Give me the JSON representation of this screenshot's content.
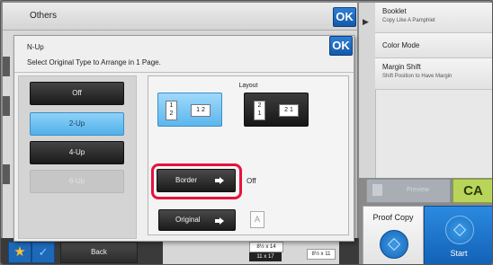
{
  "others_window": {
    "title": "Others",
    "ok_label": "OK"
  },
  "sidebar": {
    "items": [
      {
        "title": "Booklet",
        "subtitle": "Copy Like A Pamphlet"
      },
      {
        "title": "Color Mode",
        "subtitle": ""
      },
      {
        "title": "Margin Shift",
        "subtitle": "Shift Position to Have Margin"
      }
    ]
  },
  "actions": {
    "preview_label": "Preview",
    "ca_label": "CA",
    "proof_copy_label": "Proof Copy",
    "start_label": "Start",
    "back_label": "Back"
  },
  "trays": {
    "paper_1": "8½ x 14",
    "paper_2": "11 x 17",
    "paper_3": "8½ x 11"
  },
  "nup_dialog": {
    "title": "N-Up",
    "ok_label": "OK",
    "instruction": "Select Original Type to Arrange in 1 Page.",
    "options": [
      {
        "label": "Off",
        "state": "normal"
      },
      {
        "label": "2-Up",
        "state": "selected"
      },
      {
        "label": "4-Up",
        "state": "normal"
      },
      {
        "label": "6-Up",
        "state": "disabled"
      }
    ],
    "layout_label": "Layout",
    "layout_a": {
      "p1": "1",
      "p2": "2",
      "p3": "1",
      "p4": "2"
    },
    "layout_b": {
      "p1": "2",
      "p2": "1",
      "p3": "2",
      "p4": "1"
    },
    "border_label": "Border",
    "border_value": "Off",
    "original_label": "Original",
    "original_icon": "A"
  },
  "colors": {
    "accent_blue": "#1e68b8",
    "selected": "#5cb6ee",
    "highlight": "#e8113d",
    "ca": "#b8d45a"
  }
}
